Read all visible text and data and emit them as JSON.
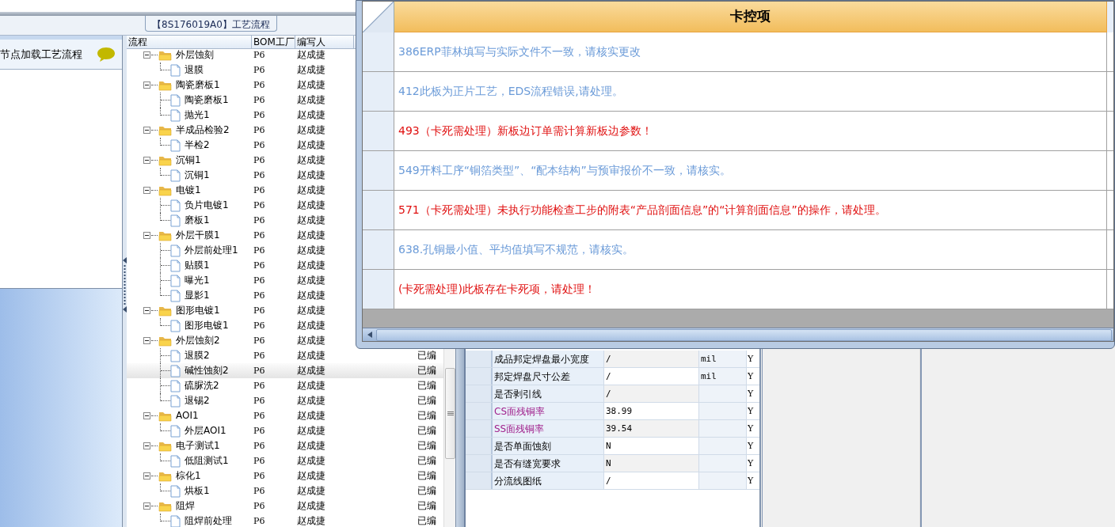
{
  "document_tab": {
    "label": "【8S176019A0】工艺流程"
  },
  "left_panel": {
    "hint": "节点加载工艺流程"
  },
  "tree": {
    "columns": [
      "流程",
      "BOM工厂",
      "编写人"
    ],
    "nodes": [
      {
        "label": "外层蚀刻",
        "bom": "P6",
        "author": "赵成捷",
        "expanded": true,
        "selected": false,
        "children": [
          {
            "label": "退膜",
            "bom": "P6",
            "author": "赵成捷",
            "selected": false
          }
        ]
      },
      {
        "label": "陶瓷磨板1",
        "bom": "P6",
        "author": "赵成捷",
        "expanded": true,
        "selected": false,
        "children": [
          {
            "label": "陶瓷磨板1",
            "bom": "P6",
            "author": "赵成捷",
            "selected": false
          },
          {
            "label": "抛光1",
            "bom": "P6",
            "author": "赵成捷",
            "selected": false
          }
        ]
      },
      {
        "label": "半成品检验2",
        "bom": "P6",
        "author": "赵成捷",
        "expanded": true,
        "selected": false,
        "children": [
          {
            "label": "半检2",
            "bom": "P6",
            "author": "赵成捷",
            "selected": false
          }
        ]
      },
      {
        "label": "沉铜1",
        "bom": "P6",
        "author": "赵成捷",
        "expanded": true,
        "selected": false,
        "children": [
          {
            "label": "沉铜1",
            "bom": "P6",
            "author": "赵成捷",
            "selected": false
          }
        ]
      },
      {
        "label": "电镀1",
        "bom": "P6",
        "author": "赵成捷",
        "expanded": true,
        "selected": false,
        "children": [
          {
            "label": "负片电镀1",
            "bom": "P6",
            "author": "赵成捷",
            "selected": false
          },
          {
            "label": "磨板1",
            "bom": "P6",
            "author": "赵成捷",
            "selected": false
          }
        ]
      },
      {
        "label": "外层干膜1",
        "bom": "P6",
        "author": "赵成捷",
        "expanded": true,
        "selected": false,
        "children": [
          {
            "label": "外层前处理1",
            "bom": "P6",
            "author": "赵成捷",
            "selected": false
          },
          {
            "label": "贴膜1",
            "bom": "P6",
            "author": "赵成捷",
            "selected": false
          },
          {
            "label": "曝光1",
            "bom": "P6",
            "author": "赵成捷",
            "selected": false
          },
          {
            "label": "显影1",
            "bom": "P6",
            "author": "赵成捷",
            "selected": false
          }
        ]
      },
      {
        "label": "图形电镀1",
        "bom": "P6",
        "author": "赵成捷",
        "expanded": true,
        "selected": false,
        "children": [
          {
            "label": "图形电镀1",
            "bom": "P6",
            "author": "赵成捷",
            "selected": false
          }
        ]
      },
      {
        "label": "外层蚀刻2",
        "bom": "P6",
        "author": "赵成捷",
        "expanded": true,
        "selected": false,
        "children": [
          {
            "label": "退膜2",
            "bom": "P6",
            "author": "赵成捷",
            "status": "已编",
            "selected": false
          },
          {
            "label": "碱性蚀刻2",
            "bom": "P6",
            "author": "赵成捷",
            "status": "已编",
            "selected": true
          },
          {
            "label": "硫脲洗2",
            "bom": "P6",
            "author": "赵成捷",
            "status": "已编",
            "selected": false
          },
          {
            "label": "退锡2",
            "bom": "P6",
            "author": "赵成捷",
            "status": "已编",
            "selected": false
          }
        ]
      },
      {
        "label": "AOI1",
        "bom": "P6",
        "author": "赵成捷",
        "status": "已编",
        "expanded": true,
        "selected": false,
        "children": [
          {
            "label": "外层AOI1",
            "bom": "P6",
            "author": "赵成捷",
            "status": "已编",
            "selected": false
          }
        ]
      },
      {
        "label": "电子测试1",
        "bom": "P6",
        "author": "赵成捷",
        "status": "已编",
        "expanded": true,
        "selected": false,
        "children": [
          {
            "label": "低阻测试1",
            "bom": "P6",
            "author": "赵成捷",
            "status": "已编",
            "selected": false
          }
        ]
      },
      {
        "label": "棕化1",
        "bom": "P6",
        "author": "赵成捷",
        "status": "已编",
        "expanded": true,
        "selected": false,
        "children": [
          {
            "label": "烘板1",
            "bom": "P6",
            "author": "赵成捷",
            "status": "已编",
            "selected": false
          }
        ]
      },
      {
        "label": "阻焊",
        "bom": "P6",
        "author": "赵成捷",
        "status": "已编",
        "expanded": true,
        "selected": false,
        "children": [
          {
            "label": "阻焊前处理",
            "bom": "P6",
            "author": "赵成捷",
            "status": "已编",
            "selected": false
          }
        ]
      }
    ]
  },
  "parameters": [
    {
      "name": "成品邦定焊盘最小宽度",
      "value": "/",
      "unit": "mil",
      "flag": "Y",
      "highlighted": false
    },
    {
      "name": "邦定焊盘尺寸公差",
      "value": "/",
      "unit": "mil",
      "flag": "Y",
      "highlighted": false
    },
    {
      "name": "是否剥引线",
      "value": "/",
      "flag": "Y",
      "highlighted": false
    },
    {
      "name": "CS面残铜率",
      "value": "38.99",
      "flag": "Y",
      "highlighted": true
    },
    {
      "name": "SS面残铜率",
      "value": "39.54",
      "flag": "Y",
      "highlighted": true
    },
    {
      "name": "是否单面蚀刻",
      "value": "N",
      "flag": "Y",
      "highlighted": false
    },
    {
      "name": "是否有缝宽要求",
      "value": "N",
      "flag": "Y",
      "highlighted": false
    },
    {
      "name": "分流线图纸",
      "value": "/",
      "flag": "Y",
      "highlighted": false
    }
  ],
  "check_dialog": {
    "header": "卡控项",
    "rows": [
      {
        "text": "386ERP菲林填写与实际文件不一致，请核实更改",
        "color": "#6b9bd8"
      },
      {
        "text": "412此板为正片工艺，EDS流程错误,请处理。",
        "color": "#6b9bd8"
      },
      {
        "text": "493（卡死需处理）新板边订单需计算新板边参数！",
        "color": "#e01010"
      },
      {
        "text": "549开料工序“铜箔类型”、“配本结构”与预审报价不一致，请核实。",
        "color": "#6b9bd8"
      },
      {
        "text": "571（卡死需处理）未执行功能检查工步的附表“产品剖面信息”的“计算剖面信息”的操作，请处理。",
        "color": "#e01010"
      },
      {
        "text": "638.孔铜最小值、平均值填写不规范，请核实。",
        "color": "#6b9bd8"
      },
      {
        "text": "(卡死需处理)此板存在卡死项，请处理！",
        "color": "#e01010"
      }
    ]
  }
}
